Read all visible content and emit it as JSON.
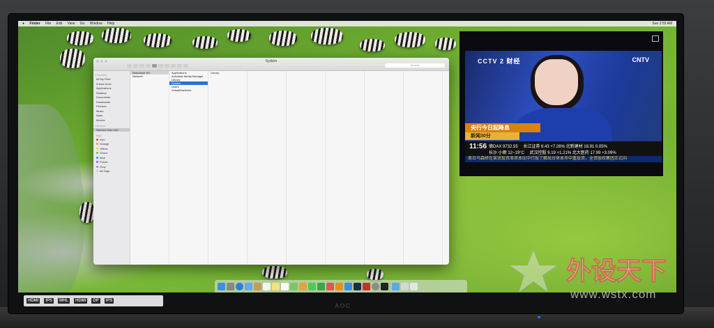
{
  "menubar": {
    "apple": "",
    "items": [
      "Finder",
      "File",
      "Edit",
      "View",
      "Go",
      "Window",
      "Help"
    ],
    "clock": "Sun 2:55 AM"
  },
  "finder": {
    "title": "System",
    "search_placeholder": "Search",
    "sidebar": {
      "favorites_header": "Favorites",
      "favorites": [
        "All My Files",
        "iCloud Drive",
        "Applications",
        "Desktop",
        "Documents",
        "Downloads",
        "Pictures",
        "Music",
        "Apps",
        "Movies"
      ],
      "devices_header": "Devices",
      "devices": [
        "Nandu's Mac mini"
      ],
      "tags_header": "Tags",
      "tags": [
        {
          "label": "Red",
          "color": "#e8443a"
        },
        {
          "label": "Orange",
          "color": "#f39a2b"
        },
        {
          "label": "Yellow",
          "color": "#f2cf2d"
        },
        {
          "label": "Green",
          "color": "#5fc24a"
        },
        {
          "label": "Blue",
          "color": "#3a85e8"
        },
        {
          "label": "Purple",
          "color": "#a35ad6"
        },
        {
          "label": "Gray",
          "color": "#9a9a9a"
        },
        {
          "label": "All Tags...",
          "color": "#cccccc"
        }
      ]
    },
    "column1": [
      "Macintosh HD",
      "Network"
    ],
    "column2": [
      "Applications",
      "Autodesk Media Manager",
      "Library",
      "System",
      "Users",
      "VirtualMachines"
    ],
    "column2_selected": "System",
    "column3": [
      "Library"
    ]
  },
  "tv": {
    "channel_logo": "CCTV 2 财经",
    "network_logo": "CNTV",
    "headline": "央行今日起降息",
    "subheadline": "新闻30分",
    "time": "11:56",
    "ticker_line1": "德DAX 9732.55",
    "ticker_line1b": "长江证券 8.43 +7.26% 北新建材 18.91 0.05%",
    "ticker_line2": "长沙 小雨 12~19°C",
    "ticker_line2b": "武汉控股 9.19 +1.21% 北大医药 17.99 +3.09%",
    "scroll": "美日马森研在某贸投资准资本比中行投了解出台来本市中重投资，全资股权集团正式向"
  },
  "monitor": {
    "brand": "AOC",
    "badges": [
      "HDMI",
      "IPS",
      "MHL",
      "HDMI",
      "DP",
      "IPS"
    ]
  },
  "watermark": {
    "text": "外设天下",
    "url": "www.wstx.com"
  },
  "colors": {
    "selection_blue": "#2f6fdc",
    "grass_green": "#79b836",
    "tv_blue": "#2d4fc2"
  }
}
